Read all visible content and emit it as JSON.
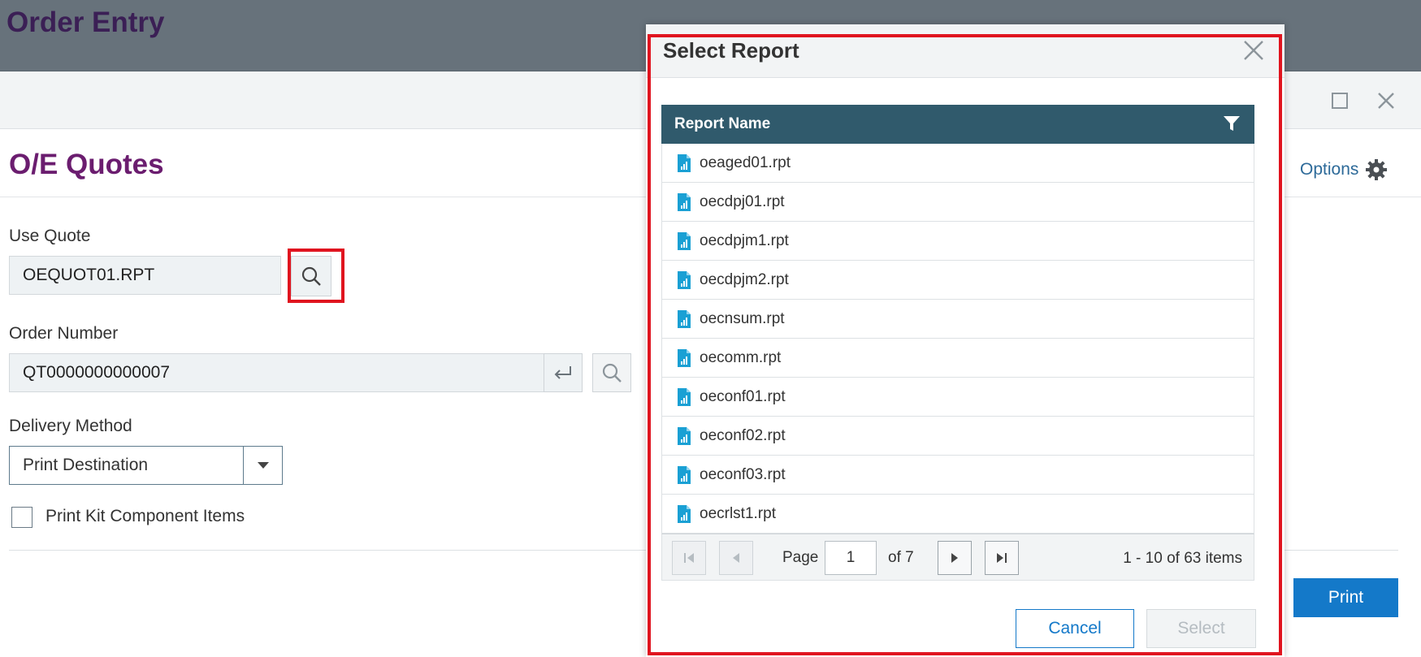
{
  "app": {
    "title": "Order Entry"
  },
  "page": {
    "title": "O/E Quotes",
    "options_label": "Options"
  },
  "form": {
    "use_quote": {
      "label": "Use Quote",
      "value": "OEQUOT01.RPT"
    },
    "order_number": {
      "label": "Order Number",
      "value": "QT0000000000007"
    },
    "delivery_method": {
      "label": "Delivery Method",
      "value": "Print Destination"
    },
    "print_kit": {
      "label": "Print Kit Component Items",
      "checked": false
    },
    "print_label": "Print"
  },
  "dialog": {
    "title": "Select Report",
    "column_header": "Report Name",
    "rows": [
      "oeaged01.rpt",
      "oecdpj01.rpt",
      "oecdpjm1.rpt",
      "oecdpjm2.rpt",
      "oecnsum.rpt",
      "oecomm.rpt",
      "oeconf01.rpt",
      "oeconf02.rpt",
      "oeconf03.rpt",
      "oecrlst1.rpt"
    ],
    "pager": {
      "page_label": "Page",
      "page_value": "1",
      "of_label": "of 7",
      "summary": "1 - 10 of 63 items"
    },
    "cancel_label": "Cancel",
    "select_label": "Select"
  },
  "colors": {
    "header_bg": "#67727b",
    "grid_header_bg": "#305a6c",
    "accent_blue": "#1479c9",
    "title_purple": "#6b1d6f",
    "highlight_red": "#e0141f"
  }
}
